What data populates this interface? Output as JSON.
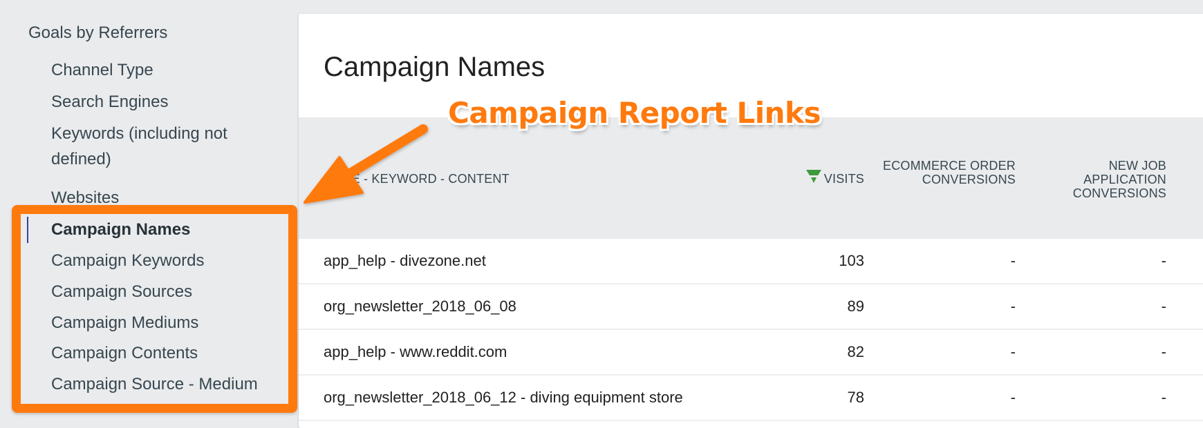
{
  "sidebar": {
    "heading": "Goals by Referrers",
    "items": [
      {
        "label": "Channel Type",
        "active": false
      },
      {
        "label": "Search Engines",
        "active": false
      },
      {
        "label": "Keywords (including not defined)",
        "active": false
      },
      {
        "label": "Websites",
        "active": false
      },
      {
        "label": "Campaign Names",
        "active": true
      },
      {
        "label": "Campaign Keywords",
        "active": false
      },
      {
        "label": "Campaign Sources",
        "active": false
      },
      {
        "label": "Campaign Mediums",
        "active": false
      },
      {
        "label": "Campaign Contents",
        "active": false
      },
      {
        "label": "Campaign Source - Medium",
        "active": false
      }
    ]
  },
  "report": {
    "title": "Campaign Names",
    "columns": {
      "label": "NAME - KEYWORD - CONTENT",
      "visits": "VISITS",
      "ecommerce": "ECOMMERCE ORDER CONVERSIONS",
      "new_job": "NEW JOB APPLICATION CONVERSIONS"
    },
    "sort": {
      "column": "visits",
      "direction": "descending",
      "icon": "sort-descending-icon",
      "color": "#3c9a3c"
    },
    "rows": [
      {
        "label": "app_help - divezone.net",
        "visits": "103",
        "ecommerce": "-",
        "new_job": "-"
      },
      {
        "label": "org_newsletter_2018_06_08",
        "visits": "89",
        "ecommerce": "-",
        "new_job": "-"
      },
      {
        "label": "app_help - www.reddit.com",
        "visits": "82",
        "ecommerce": "-",
        "new_job": "-"
      },
      {
        "label": "org_newsletter_2018_06_12 - diving equipment store",
        "visits": "78",
        "ecommerce": "-",
        "new_job": "-"
      }
    ]
  },
  "annotation": {
    "text": "Campaign Report Links",
    "color": "#ff7a0e"
  },
  "theme": {
    "active_indicator": "#3a3f9e",
    "background": "#eaebed"
  }
}
